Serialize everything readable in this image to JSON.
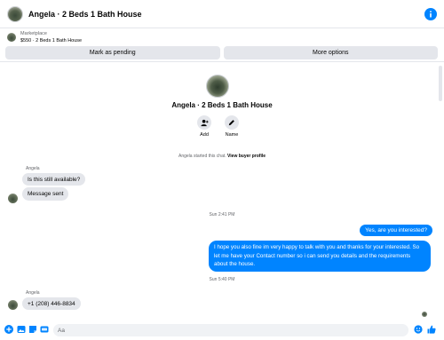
{
  "header": {
    "title": "Angela · 2 Beds 1 Bath House",
    "info_icon": "info-icon"
  },
  "listing": {
    "label": "Marketplace",
    "subtitle": "$550 · 2 Beds 1 Bath House"
  },
  "buttons": {
    "pending": "Mark as pending",
    "more": "More options"
  },
  "profile": {
    "name": "Angela · 2 Beds 1 Bath House",
    "actions": [
      {
        "label": "Add",
        "icon": "add-person-icon"
      },
      {
        "label": "Name",
        "icon": "pencil-icon"
      }
    ]
  },
  "started": {
    "text": "Angela started this chat.",
    "link": "View buyer profile"
  },
  "messages": {
    "sender1": "Angela",
    "in1": "Is this still available?",
    "in2": "Message sent",
    "time1": "Sun 2:41 PM",
    "out1": "Yes, are you interested?",
    "out2": "I hope you also fine im very happy to talk with you and thanks for your interested. So let me have your Contact number so i can send you details and the requirements about the house.",
    "time2": "Sun 5:40 PM",
    "sender2": "Angela",
    "in3": "+1 (208) 446-8834"
  },
  "composer": {
    "placeholder": "Aa",
    "icons": [
      "plus-icon",
      "image-icon",
      "sticker-icon",
      "gif-icon",
      "emoji-icon",
      "like-icon"
    ]
  },
  "colors": {
    "accent": "#0084ff",
    "bubble_in": "#e4e6eb"
  }
}
